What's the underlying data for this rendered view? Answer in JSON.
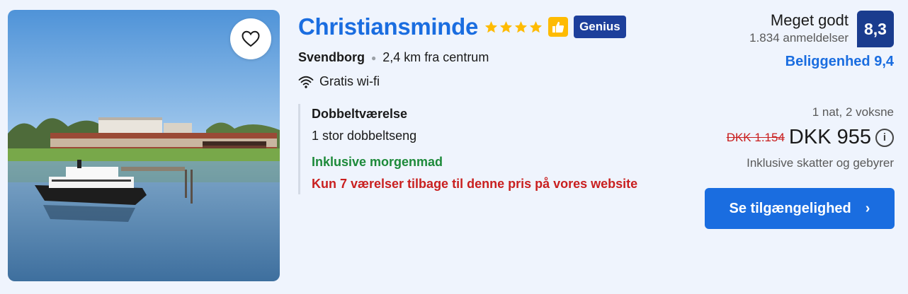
{
  "hotel": {
    "name": "Christiansminde",
    "star_count": 4,
    "badge_label": "Genius",
    "city": "Svendborg",
    "distance": "2,4 km fra centrum",
    "amenity": "Gratis wi-fi"
  },
  "room": {
    "name": "Dobbeltværelse",
    "bed": "1 stor dobbeltseng",
    "breakfast": "Inklusive morgenmad",
    "scarcity": "Kun 7 værelser tilbage til denne pris på vores website"
  },
  "review": {
    "word": "Meget godt",
    "count": "1.834 anmeldelser",
    "score": "8,3",
    "location_score": "Beliggenhed 9,4"
  },
  "pricing": {
    "occupancy": "1 nat, 2 voksne",
    "old_price": "DKK 1.154",
    "new_price": "DKK 955",
    "tax_note": "Inklusive skatter og gebyrer",
    "info_glyph": "i"
  },
  "cta": {
    "label": "Se tilgængelighed",
    "chevron": "›"
  },
  "colors": {
    "brand_blue": "#1a6de0",
    "score_navy": "#1a3c8e",
    "genius_navy": "#1d3f9b",
    "star_yellow": "#febb02",
    "green": "#1d8a3a",
    "red": "#c91f1f"
  }
}
